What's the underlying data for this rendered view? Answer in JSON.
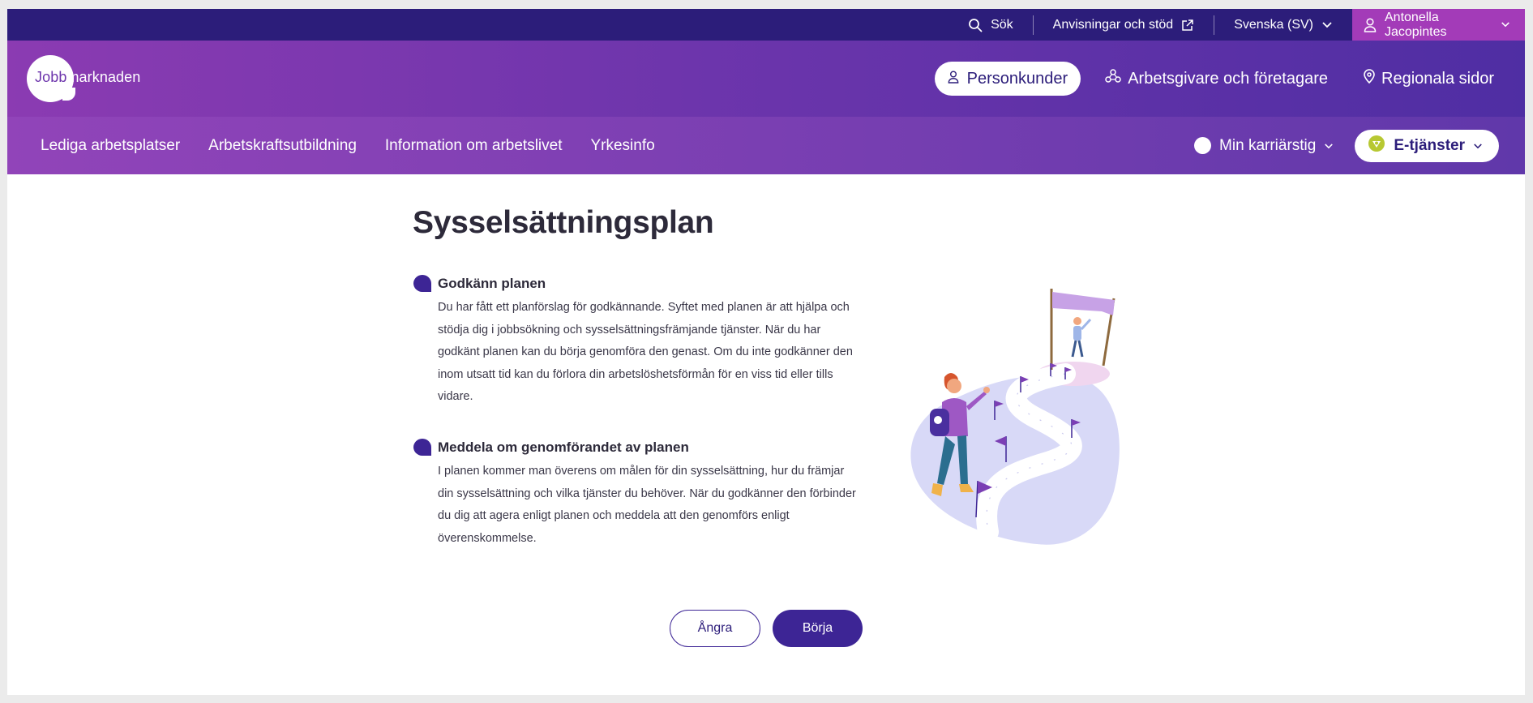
{
  "utility_bar": {
    "search_label": "Sök",
    "help_label": "Anvisningar och stöd",
    "language_label": "Svenska (SV)",
    "user_label": "Antonella Jacopintes"
  },
  "header": {
    "logo_part1": "Jobb",
    "logo_part2": "marknaden",
    "nav": {
      "personal": "Personkunder",
      "employers": "Arbetsgivare och företagare",
      "regional": "Regionala sidor"
    }
  },
  "sub_nav": {
    "items": [
      "Lediga arbetsplatser",
      "Arbetskraftsutbildning",
      "Information om arbetslivet",
      "Yrkesinfo"
    ],
    "career_label": "Min karriärstig",
    "eservices_label": "E-tjänster"
  },
  "main": {
    "title": "Sysselsättningsplan",
    "sections": [
      {
        "title": "Godkänn planen",
        "lines": [
          "Du har fått ett planförslag för godkännande. Syftet med planen är att hjälpa och",
          "stödja dig i jobbsökning och sysselsättningsfrämjande tjänster. När du har",
          "godkänt planen kan du börja genomföra den genast. Om du inte godkänner den",
          "inom utsatt tid kan du förlora din arbetslöshetsförmån för en viss tid eller tills",
          "vidare."
        ]
      },
      {
        "title": "Meddela om genomförandet av planen",
        "lines": [
          "I planen kommer man överens om målen för din sysselsättning, hur du främjar",
          "din sysselsättning och vilka tjänster du behöver. När du godkänner den förbinder",
          "du dig att agera enligt planen och meddela att den genomförs enligt",
          "överenskommelse."
        ]
      }
    ],
    "cancel_label": "Ångra",
    "start_label": "Börja"
  },
  "colors": {
    "utility_bar": "#2c1d7a",
    "user_highlight": "#a33bb8",
    "primary": "#3d2595",
    "header_gradient_start": "#8b3bb2",
    "header_gradient_end": "#4f2ea3"
  }
}
